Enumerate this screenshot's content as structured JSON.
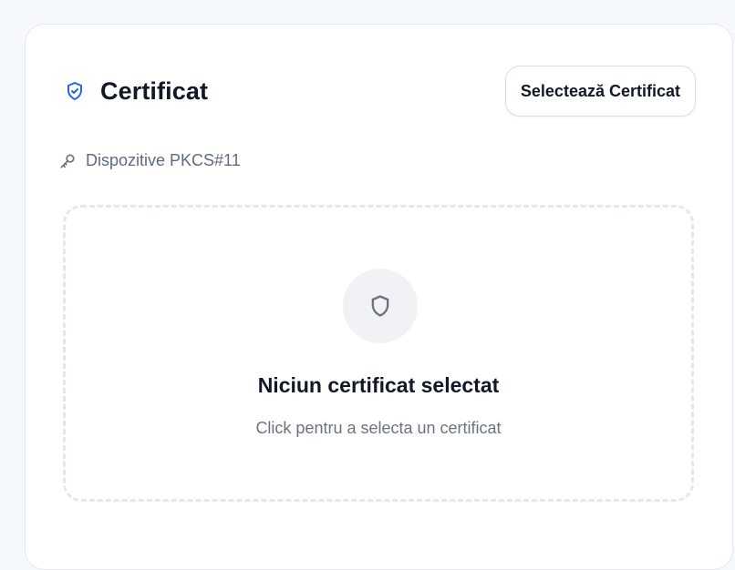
{
  "card": {
    "title": "Certificat",
    "select_button_label": "Selectează Certificat",
    "device_label": "Dispozitive PKCS#11"
  },
  "dropzone": {
    "title": "Niciun certificat selectat",
    "subtitle": "Click pentru a selecta un certificat"
  },
  "icons": {
    "title": "shield-check-icon",
    "device": "key-icon",
    "empty_state": "shield-icon"
  },
  "colors": {
    "accent": "#2563eb",
    "text": "#111827",
    "muted": "#6b7280",
    "border": "#e3e8ee",
    "dashed_border": "#e4e7ee"
  }
}
